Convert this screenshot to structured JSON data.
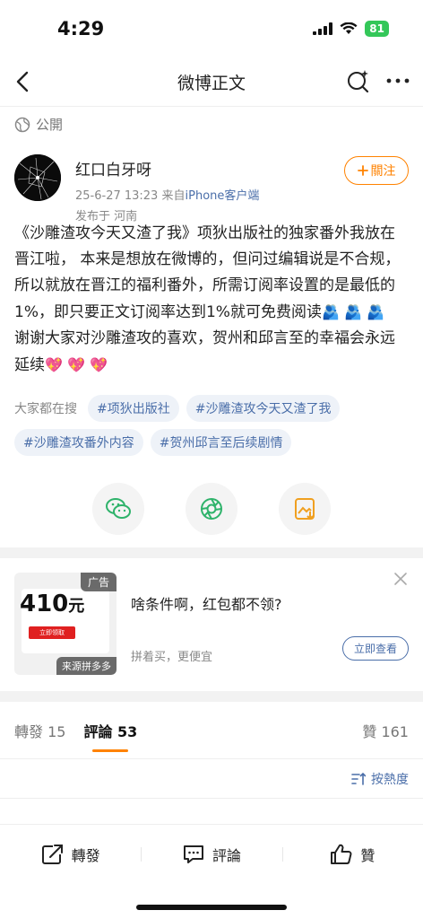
{
  "status_bar": {
    "time": "4:29",
    "battery": "81"
  },
  "nav": {
    "title": "微博正文"
  },
  "visibility": {
    "label": "公開"
  },
  "post": {
    "author": "红口白牙呀",
    "time": "25-6-27 13:23",
    "source_prefix": "来自",
    "source": "iPhone客户端",
    "location": "发布于 河南",
    "follow_label": "關注",
    "body_para1": "《沙雕渣攻今天又渣了我》项狄出版社的独家番外我放在晋江啦， 本来是想放在微博的，但问过编辑说是不合规，所以就放在晋江的福利番外，所需订阅率设置的是最低的1%，即只要正文订阅率达到1%就可免费阅读",
    "body_para1_emoji": "🫂 🫂 🫂",
    "body_para2": "谢谢大家对沙雕渣攻的喜欢，贺州和邱言至的幸福会永远延续",
    "body_para2_emoji": "💖 💖 💖"
  },
  "search": {
    "label": "大家都在搜",
    "tags": [
      "#项狄出版社",
      "#沙雕渣攻今天又渣了我",
      "#沙雕渣攻番外内容",
      "#贺州邱言至后续剧情"
    ]
  },
  "share": {
    "icons": [
      "wechat-icon",
      "moments-icon",
      "save-image-icon"
    ]
  },
  "ad": {
    "badge": "广告",
    "price": "410",
    "price_unit": "元",
    "mini_cta": "立即领取",
    "source": "来源拼多多",
    "title": "啥条件啊，红包都不领?",
    "subtitle": "拼着买，更便宜",
    "cta": "立即查看"
  },
  "tabs": {
    "repost": "轉發 15",
    "comment_label": "評論",
    "comment_count": "53",
    "like": "贊 161"
  },
  "sort": {
    "label": "按熱度"
  },
  "bottom": {
    "repost": "轉發",
    "comment": "評論",
    "like": "贊"
  },
  "colors": {
    "accent": "#ff8200",
    "link": "#4a6ea9"
  }
}
